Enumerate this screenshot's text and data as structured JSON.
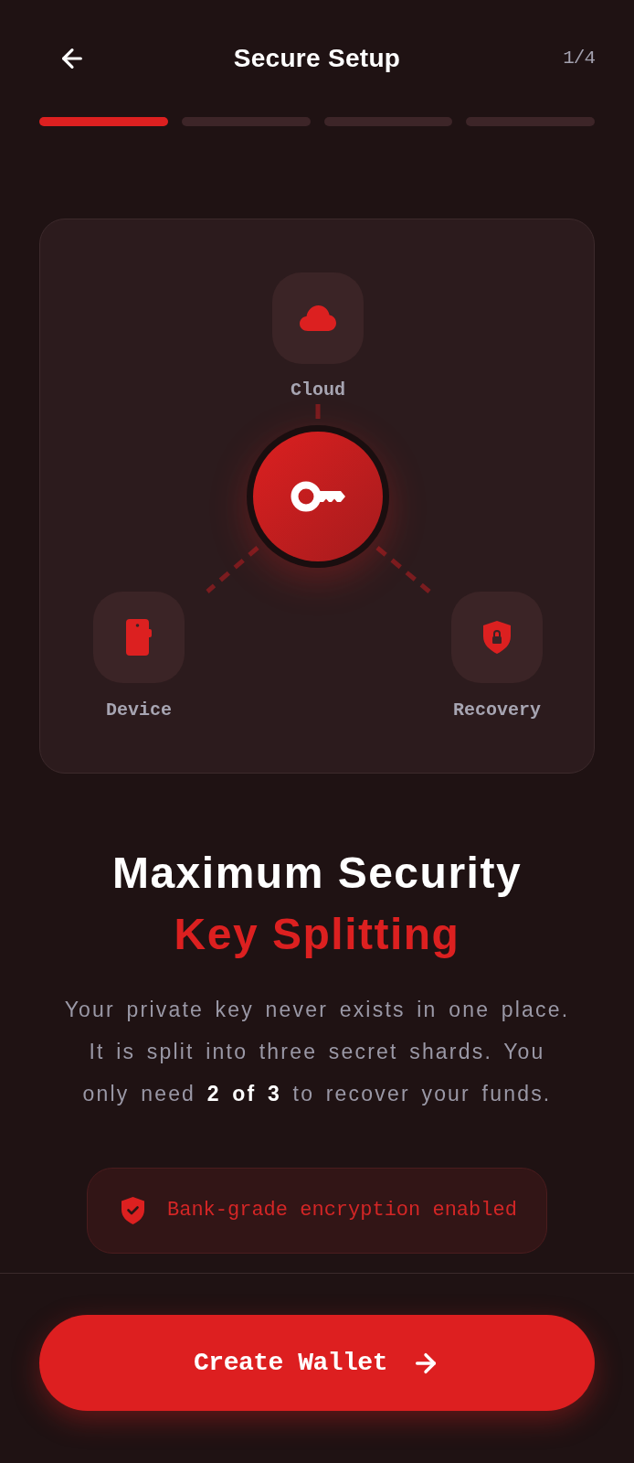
{
  "header": {
    "title": "Secure Setup",
    "step": "1/4"
  },
  "progress": [
    {
      "active": true
    },
    {
      "active": false
    },
    {
      "active": false
    },
    {
      "active": false
    }
  ],
  "diagram": {
    "nodes": [
      {
        "kind": "cloud",
        "label": "Cloud"
      },
      {
        "kind": "device",
        "label": "Device"
      },
      {
        "kind": "recovery",
        "label": "Recovery"
      }
    ]
  },
  "heading": {
    "title": "Maximum Security",
    "highlight": "Key Splitting"
  },
  "description": "Your private key never exists in one place. It is split into three secret shards. You only need **2 of 3** to recover your funds.",
  "notice": "Bank-grade encryption enabled",
  "primary_button": {
    "label": "Create Wallet"
  }
}
